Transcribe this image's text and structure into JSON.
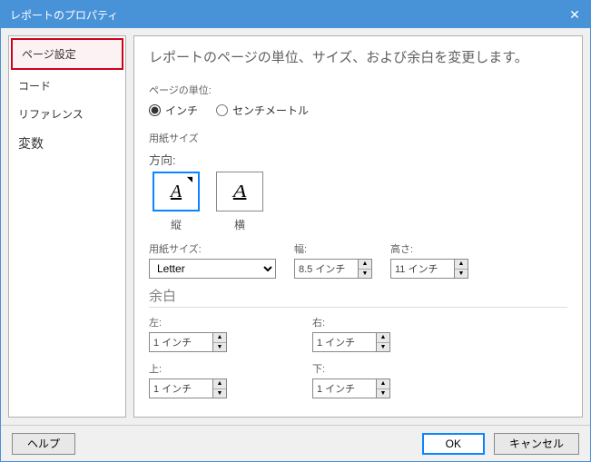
{
  "window": {
    "title": "レポートのプロパティ"
  },
  "sidebar": {
    "items": [
      {
        "label": "ページ設定"
      },
      {
        "label": "コード"
      },
      {
        "label": "リファレンス"
      },
      {
        "label": "変数"
      }
    ]
  },
  "main": {
    "subtitle": "レポートのページの単位、サイズ、および余白を変更します。",
    "unit_section": "ページの単位:",
    "unit_inch": "インチ",
    "unit_cm": "センチメートル",
    "paper_section": "用紙サイズ",
    "orientation_label": "方向:",
    "orient_portrait": "縦",
    "orient_landscape": "横",
    "paper_size_label": "用紙サイズ:",
    "paper_size_value": "Letter",
    "width_label": "幅:",
    "width_value": "8.5 インチ",
    "height_label": "高さ:",
    "height_value": "11 インチ",
    "margin_header": "余白",
    "margin_left_label": "左:",
    "margin_right_label": "右:",
    "margin_top_label": "上:",
    "margin_bottom_label": "下:",
    "margin_value": "1 インチ"
  },
  "footer": {
    "help": "ヘルプ",
    "ok": "OK",
    "cancel": "キャンセル"
  }
}
